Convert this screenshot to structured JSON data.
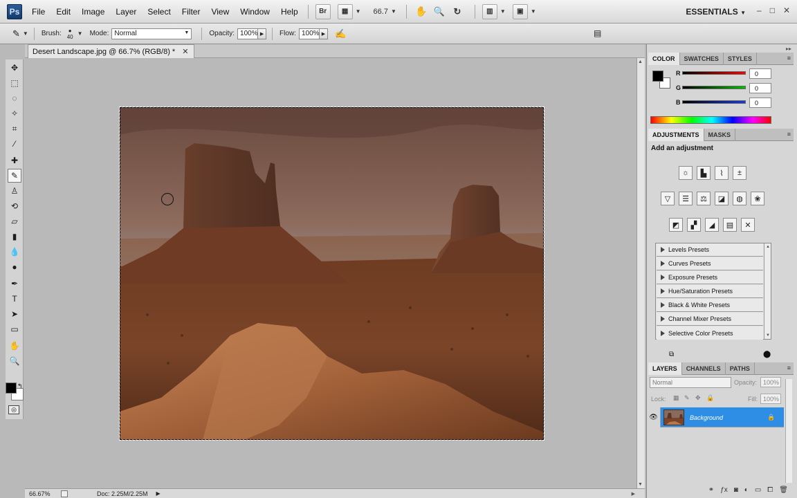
{
  "menu": {
    "items": [
      "File",
      "Edit",
      "Image",
      "Layer",
      "Select",
      "Filter",
      "View",
      "Window",
      "Help"
    ],
    "bridge_label": "Br",
    "zoom_value": "66.7",
    "workspace": "ESSENTIALS"
  },
  "options": {
    "brush_label": "Brush:",
    "brush_size": "40",
    "mode_label": "Mode:",
    "mode_value": "Normal",
    "opacity_label": "Opacity:",
    "opacity_value": "100%",
    "flow_label": "Flow:",
    "flow_value": "100%"
  },
  "document": {
    "tab_title": "Desert Landscape.jpg @ 66.7% (RGB/8) *",
    "status_zoom": "66.67%",
    "status_doc": "Doc: 2.25M/2.25M"
  },
  "color_panel": {
    "tabs": [
      "COLOR",
      "SWATCHES",
      "STYLES"
    ],
    "channels": [
      {
        "label": "R",
        "value": "0",
        "color": "#d81e1e"
      },
      {
        "label": "G",
        "value": "0",
        "color": "#1ea83a"
      },
      {
        "label": "B",
        "value": "0",
        "color": "#2140d0"
      }
    ]
  },
  "adjustments_panel": {
    "tabs": [
      "ADJUSTMENTS",
      "MASKS"
    ],
    "title": "Add an adjustment",
    "presets": [
      "Levels Presets",
      "Curves Presets",
      "Exposure Presets",
      "Hue/Saturation Presets",
      "Black & White Presets",
      "Channel Mixer Presets",
      "Selective Color Presets"
    ]
  },
  "layers_panel": {
    "tabs": [
      "LAYERS",
      "CHANNELS",
      "PATHS"
    ],
    "blend_mode": "Normal",
    "opacity_label": "Opacity:",
    "opacity_value": "100%",
    "lock_label": "Lock:",
    "fill_label": "Fill:",
    "fill_value": "100%",
    "layer_name": "Background"
  },
  "colors": {
    "accent": "#2e8ee6",
    "foreground": "#000000",
    "background": "#ffffff"
  }
}
